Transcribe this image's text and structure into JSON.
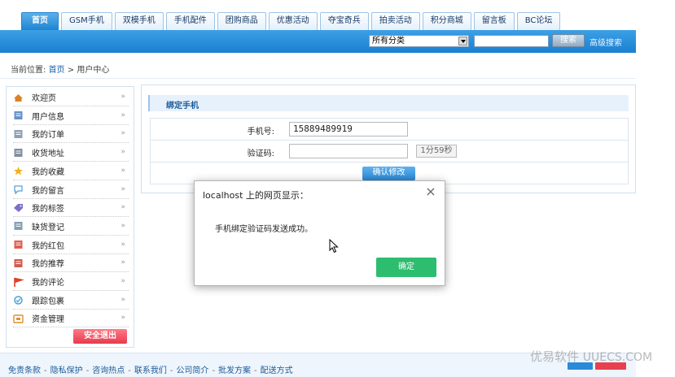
{
  "nav": {
    "tabs": [
      "首页",
      "GSM手机",
      "双模手机",
      "手机配件",
      "团购商品",
      "优惠活动",
      "夺宝奇兵",
      "拍卖活动",
      "积分商城",
      "留言板",
      "BC论坛"
    ],
    "active_tab": "首页"
  },
  "search": {
    "category": "所有分类",
    "button": "搜索",
    "advanced": "高级搜索"
  },
  "breadcrumb": {
    "prefix": "当前位置:",
    "home": "首页",
    "sep": ">",
    "current": "用户中心"
  },
  "sidebar": {
    "items": [
      {
        "label": "欢迎页",
        "icon": "home-icon",
        "color": "#d9822b"
      },
      {
        "label": "用户信息",
        "icon": "id-card-icon",
        "color": "#4a7fbf"
      },
      {
        "label": "我的订单",
        "icon": "document-icon",
        "color": "#7a8fa6"
      },
      {
        "label": "收货地址",
        "icon": "address-book-icon",
        "color": "#6b7d8f"
      },
      {
        "label": "我的收藏",
        "icon": "star-icon",
        "color": "#f2b01e"
      },
      {
        "label": "我的留言",
        "icon": "speech-bubble-icon",
        "color": "#5aa0d8"
      },
      {
        "label": "我的标签",
        "icon": "tag-icon",
        "color": "#7a6fc9"
      },
      {
        "label": "缺货登记",
        "icon": "notepad-icon",
        "color": "#6b8fa8"
      },
      {
        "label": "我的红包",
        "icon": "red-envelope-icon",
        "color": "#d9432f"
      },
      {
        "label": "我的推荐",
        "icon": "recommend-icon",
        "color": "#c9402f"
      },
      {
        "label": "我的评论",
        "icon": "flag-icon",
        "color": "#e0402a"
      },
      {
        "label": "跟踪包裹",
        "icon": "package-icon",
        "color": "#4a9fd8"
      },
      {
        "label": "资金管理",
        "icon": "wallet-icon",
        "color": "#e0902a"
      }
    ],
    "arrow": "»",
    "logout": "安全退出"
  },
  "panel": {
    "title": "绑定手机",
    "phone_label": "手机号:",
    "phone_value": "15889489919",
    "code_label": "验证码:",
    "code_value": "",
    "countdown": "1分59秒",
    "confirm": "确认修改"
  },
  "footer": {
    "links": [
      "免责条款",
      "隐私保护",
      "咨询热点",
      "联系我们",
      "公司简介",
      "批发方案",
      "配送方式"
    ]
  },
  "dialog": {
    "title": "localhost 上的网页显示：",
    "message": "手机绑定验证码发送成功。",
    "ok": "确定"
  },
  "watermark": {
    "cn": "优易软件",
    "en": "UUECS.COM"
  },
  "colors": {
    "nav_blue": "#1a7fd0",
    "ok_green": "#2dbd6e",
    "logout_red": "#e63a4c"
  }
}
